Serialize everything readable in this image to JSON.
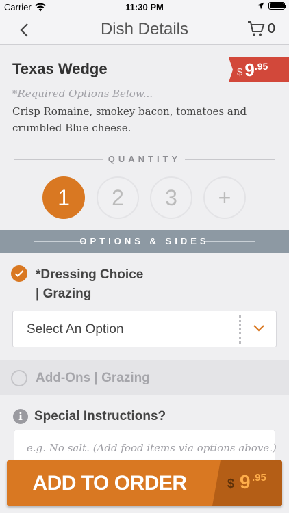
{
  "status_bar": {
    "carrier": "Carrier",
    "time": "11:30 PM"
  },
  "nav": {
    "title": "Dish Details",
    "cart_count": "0"
  },
  "dish": {
    "name": "Texas Wedge",
    "price_currency": "$",
    "price_whole": "9",
    "price_cents": ".95",
    "required_note": "*Required Options Below...",
    "description": "Crisp Romaine, smokey bacon, tomatoes and crumbled Blue cheese."
  },
  "quantity": {
    "label": "QUANTITY",
    "options": [
      "1",
      "2",
      "3",
      "+"
    ],
    "selected": "1"
  },
  "options_section": {
    "label": "OPTIONS & SIDES"
  },
  "dressing": {
    "title_line1": "*Dressing Choice",
    "title_line2": "| Grazing",
    "select_value": "Select An Option"
  },
  "addons": {
    "label": "Add-Ons | Grazing"
  },
  "special_instructions": {
    "title": "Special Instructions?",
    "placeholder": "e.g. No salt. (Add food items via options above.)"
  },
  "order_button": {
    "label": "ADD TO ORDER",
    "currency": "$",
    "whole": "9",
    "cents": ".95"
  },
  "colors": {
    "accent": "#d97822",
    "price_tag": "#d2483a",
    "banner": "#8d99a3"
  }
}
